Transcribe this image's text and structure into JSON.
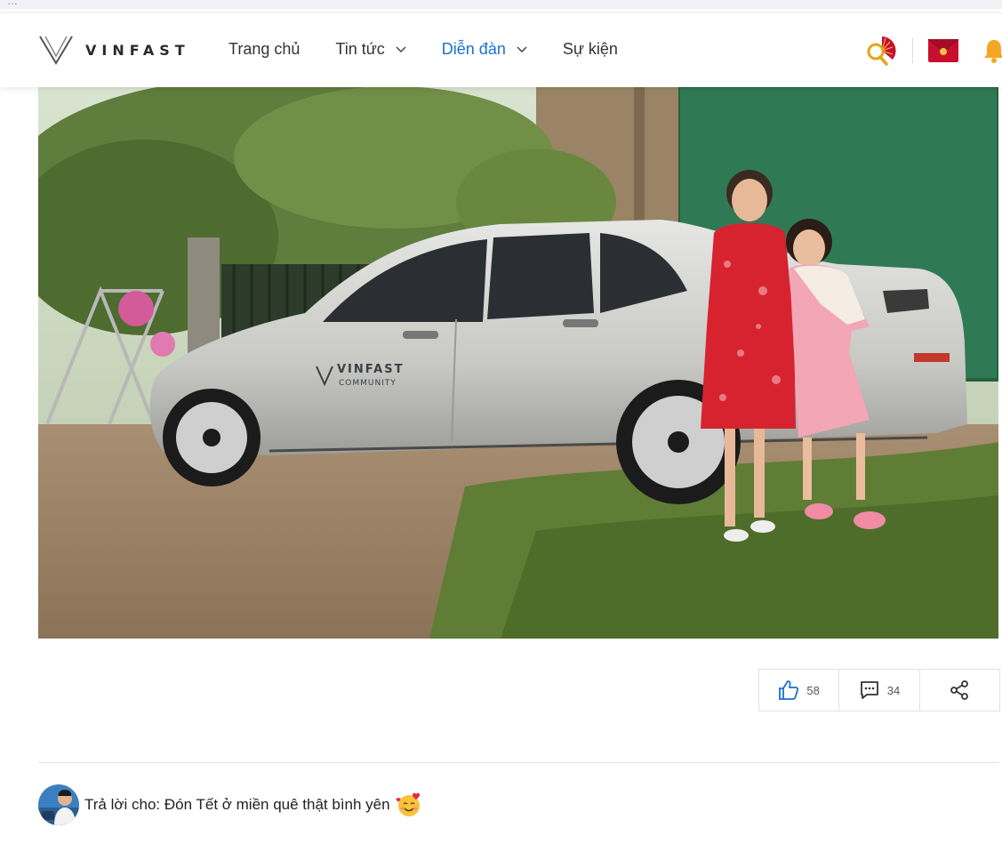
{
  "header": {
    "brand": "VINFAST",
    "nav": [
      {
        "label": "Trang chủ",
        "active": false,
        "has_dropdown": false
      },
      {
        "label": "Tin tức",
        "active": false,
        "has_dropdown": true
      },
      {
        "label": "Diễn đàn",
        "active": true,
        "has_dropdown": true
      },
      {
        "label": "Sự kiện",
        "active": false,
        "has_dropdown": false
      }
    ],
    "icons": [
      "search-fan-icon",
      "red-envelope-icon",
      "bell-icon"
    ]
  },
  "post": {
    "photo_sticker": {
      "line1": "VINFAST",
      "line2": "COMMUNITY"
    },
    "actions": {
      "like_count": "58",
      "comment_count": "34"
    }
  },
  "reply": {
    "text": "Trả lời cho: Đón Tết ở miền quê thật bình yên"
  },
  "colors": {
    "accent": "#1a6fd6",
    "bell": "#f5a623",
    "envelope": "#c8102e"
  }
}
